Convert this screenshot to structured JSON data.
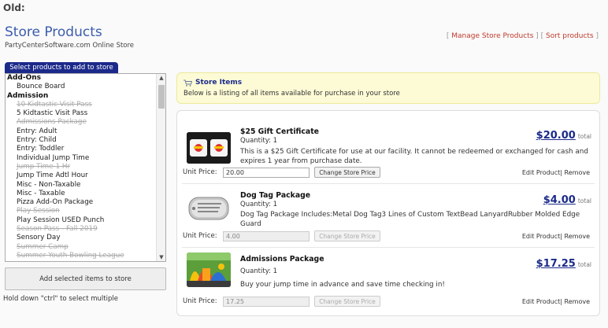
{
  "old_label": "Old:",
  "header": {
    "title": "Store Products",
    "subtitle": "PartyCenterSoftware.com Online Store",
    "link_manage": "Manage Store Products",
    "link_sort": "Sort products",
    "bracket_open": "[ ",
    "bracket_mid": " ] [ ",
    "bracket_close": " ]"
  },
  "left": {
    "tab_label": "Select products to add to store",
    "groups": [
      {
        "name": "Add-Ons",
        "items": [
          {
            "label": "Bounce Board",
            "disabled": false
          }
        ]
      },
      {
        "name": "Admission",
        "items": [
          {
            "label": "10 Kidtastic Visit Pass",
            "disabled": true
          },
          {
            "label": "5 Kidtastic Visit Pass",
            "disabled": false
          },
          {
            "label": "Admissions Package",
            "disabled": true
          },
          {
            "label": "Entry: Adult",
            "disabled": false
          },
          {
            "label": "Entry: Child",
            "disabled": false
          },
          {
            "label": "Entry: Toddler",
            "disabled": false
          },
          {
            "label": "Individual Jump Time",
            "disabled": false
          },
          {
            "label": "Jump Time 1 Hr",
            "disabled": true
          },
          {
            "label": "Jump Time Adtl Hour",
            "disabled": false
          },
          {
            "label": "Misc - Non-Taxable",
            "disabled": false
          },
          {
            "label": "Misc - Taxable",
            "disabled": false
          },
          {
            "label": "Pizza Add-On Package",
            "disabled": false
          },
          {
            "label": "Play Session",
            "disabled": true
          },
          {
            "label": "Play Session USED Punch",
            "disabled": false
          },
          {
            "label": "Season Pass - Fall 2019",
            "disabled": true
          },
          {
            "label": "Sensory Day",
            "disabled": false
          },
          {
            "label": "Summer Camp",
            "disabled": true
          },
          {
            "label": "Summer Youth Bowling League",
            "disabled": true
          }
        ]
      }
    ],
    "add_button": "Add selected items to store",
    "hint": "Hold down \"ctrl\" to select multiple"
  },
  "store": {
    "title": "Store Items",
    "description": "Below is a listing of all items available for purchase in your store",
    "unit_price_label": "Unit Price:",
    "change_price_label": "Change Store Price",
    "edit_label": "Edit Product",
    "remove_label": "Remove",
    "total_label": "total",
    "items": [
      {
        "name": "$25 Gift Certificate",
        "quantity": "Quantity: 1",
        "description": "This is a $25 Gift Certificate for use at our facility. It cannot be redeemed or exchanged for cash and expires 1 year from purchase date.",
        "price": "$20.00",
        "unit_price": "20.00",
        "editable": true,
        "thumb": "gift-card"
      },
      {
        "name": "Dog Tag Package",
        "quantity": "Quantity: 1",
        "description": "Dog Tag Package Includes:Metal Dog Tag3 Lines of Custom TextBead LanyardRubber Molded Edge Guard",
        "price": "$4.00",
        "unit_price": "4.00",
        "editable": false,
        "thumb": "dog-tag"
      },
      {
        "name": "Admissions Package",
        "quantity": "Quantity: 1",
        "description": "Buy your jump time in advance and save time checking in!",
        "price": "$17.25",
        "unit_price": "17.25",
        "editable": false,
        "thumb": "bounce-house"
      }
    ]
  },
  "colors": {
    "title_blue": "#3b5cad",
    "navy": "#1b2a8a",
    "link_red": "#c0392b",
    "notice_yellow": "#fdfbd6"
  }
}
